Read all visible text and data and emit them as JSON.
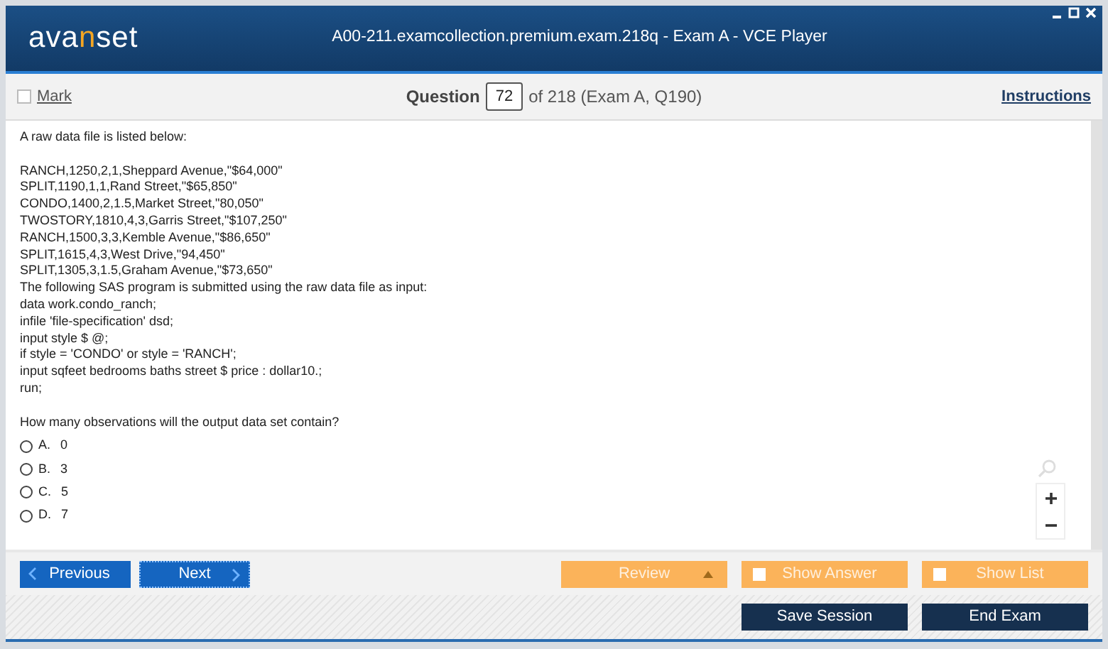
{
  "window": {
    "title": "A00-211.examcollection.premium.exam.218q - Exam A - VCE Player"
  },
  "logo": [
    {
      "text": "ava",
      "accent": false
    },
    {
      "text": "n",
      "accent": true
    },
    {
      "text": "set",
      "accent": false
    }
  ],
  "toolbar": {
    "mark": {
      "label": "Mark",
      "checked": false
    },
    "question_label": "Question",
    "question_number": "72",
    "question_of": "of 218 (Exam A, Q190)",
    "instructions": "Instructions"
  },
  "question": {
    "intro": "A raw data file is listed below:",
    "lines": [
      "RANCH,1250,2,1,Sheppard Avenue,\"$64,000\"",
      "SPLIT,1190,1,1,Rand Street,\"$65,850\"",
      "CONDO,1400,2,1.5,Market Street,\"80,050\"",
      "TWOSTORY,1810,4,3,Garris Street,\"$107,250\"",
      "RANCH,1500,3,3,Kemble Avenue,\"$86,650\"",
      "SPLIT,1615,4,3,West Drive,\"94,450\"",
      "SPLIT,1305,3,1.5,Graham Avenue,\"$73,650\"",
      "The following SAS program is submitted using the raw data file as input:",
      "data work.condo_ranch;",
      "infile 'file-specification' dsd;",
      "input style $ @;",
      "if style = 'CONDO' or style = 'RANCH';",
      "input sqfeet bedrooms baths street $ price : dollar10.;",
      "run;"
    ],
    "prompt": "How many observations will the output data set contain?",
    "options": [
      {
        "letter": "A.",
        "text": "0",
        "selected": false
      },
      {
        "letter": "B.",
        "text": "3",
        "selected": false
      },
      {
        "letter": "C.",
        "text": "5",
        "selected": false
      },
      {
        "letter": "D.",
        "text": "7",
        "selected": false
      }
    ]
  },
  "navigation": {
    "previous": "Previous",
    "next": "Next"
  },
  "review": {
    "label": "Review"
  },
  "show_answer": {
    "label": "Show Answer",
    "checked": false
  },
  "show_list": {
    "label": "Show List",
    "checked": false
  },
  "footer_buttons": [
    "Save Session",
    "End Exam"
  ]
}
